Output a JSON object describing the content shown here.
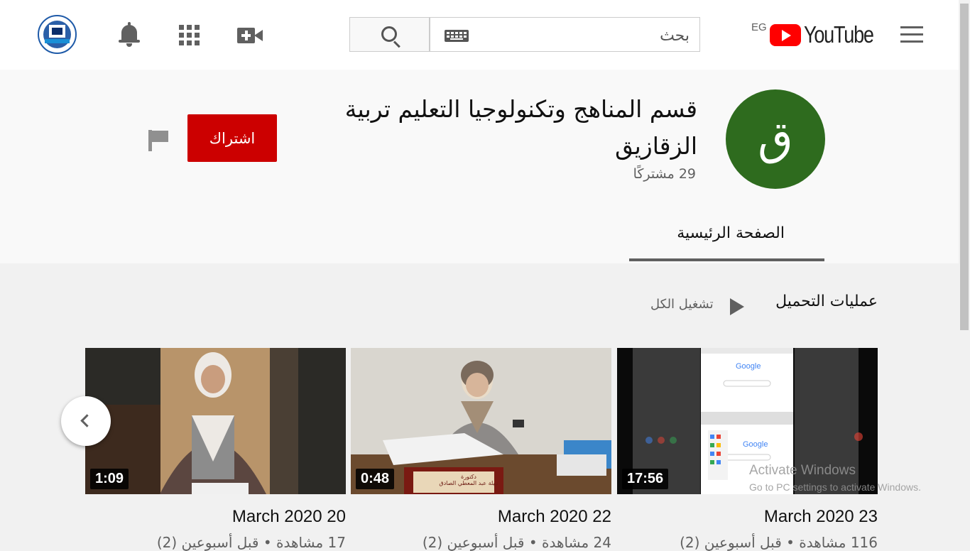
{
  "header": {
    "logo_text": "YouTube",
    "region": "EG",
    "search_placeholder": "بحث"
  },
  "channel": {
    "avatar_letter": "ق",
    "title": "قسم المناهج وتكنولوجيا التعليم تربية الزقازيق",
    "subscribers": "29 مشتركًا",
    "subscribe_label": "اشتراك",
    "tabs": [
      {
        "label": "الصفحة الرئيسية"
      }
    ]
  },
  "section": {
    "title": "عمليات التحميل",
    "play_all": "تشغيل الكل"
  },
  "videos": [
    {
      "title": "March 2020 23",
      "duration": "17:56",
      "meta": "116 مشاهدة • قبل أسبوعين (2)"
    },
    {
      "title": "March 2020 22",
      "duration": "0:48",
      "meta": "24 مشاهدة • قبل أسبوعين (2)"
    },
    {
      "title": "March 2020 20",
      "duration": "1:09",
      "meta": "17 مشاهدة • قبل أسبوعين (2)"
    }
  ],
  "thumb_text": {
    "logo": "Google",
    "nameplate_1": "دكتورة",
    "nameplate_2": "نبيلة عبد المعطي الصادق"
  },
  "watermark": {
    "line1": "Activate Windows",
    "line2": "Go to PC settings to activate Windows."
  },
  "colors": {
    "brand_red": "#ff0000",
    "subscribe_red": "#cc0000",
    "channel_avatar": "#2e6b1e"
  }
}
